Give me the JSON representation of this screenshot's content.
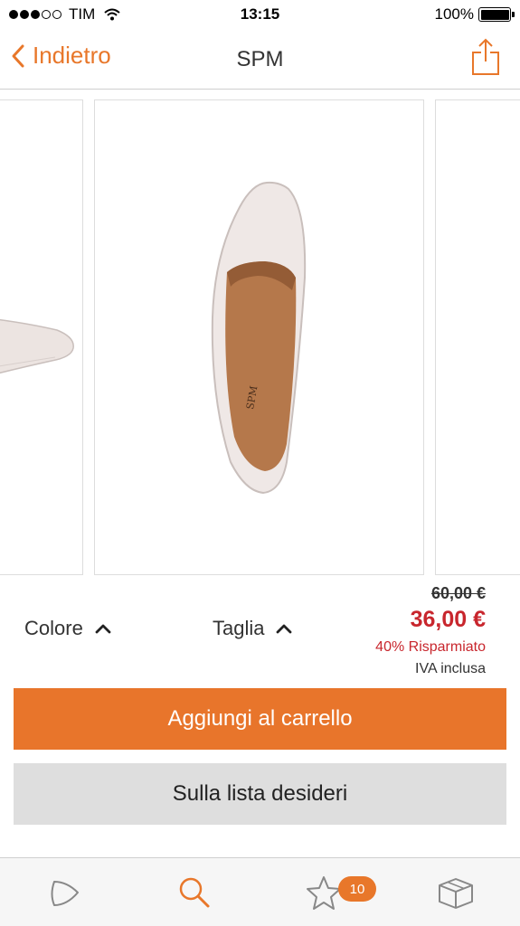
{
  "status_bar": {
    "carrier": "TIM",
    "time": "13:15",
    "battery": "100%",
    "signal_strength": 3,
    "signal_max": 5,
    "battery_level": 1.0
  },
  "nav": {
    "back_label": "Indietro",
    "title": "SPM"
  },
  "product": {
    "options": {
      "color_label": "Colore",
      "size_label": "Taglia"
    },
    "price": {
      "old": "60,00 €",
      "new": "36,00 €",
      "saving": "40% Risparmiato",
      "vat": "IVA inclusa"
    }
  },
  "actions": {
    "add_to_cart": "Aggiungi al carrello",
    "wishlist": "Sulla lista desideri"
  },
  "tab_bar": {
    "items": [
      {
        "icon": "home-icon"
      },
      {
        "icon": "search-icon"
      },
      {
        "icon": "star-icon",
        "badge": "10"
      },
      {
        "icon": "box-icon"
      }
    ]
  },
  "colors": {
    "accent": "#e8772a",
    "sale_red": "#c8262d",
    "secondary_button": "#dedede"
  }
}
